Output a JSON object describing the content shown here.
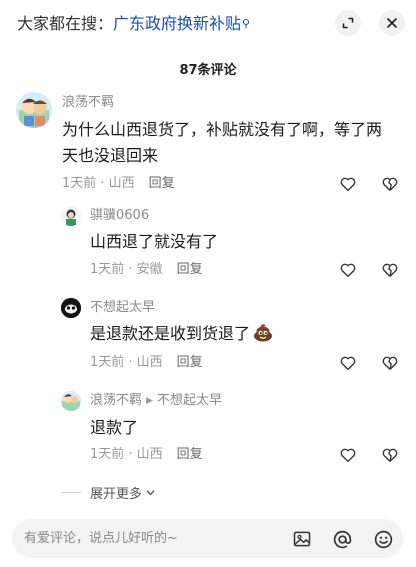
{
  "header": {
    "search_prefix": "大家都在搜：",
    "search_keyword": "广东政府换新补贴",
    "icons": {
      "expand": "expand-icon",
      "close": "close-icon"
    }
  },
  "comment_count": "87条评论",
  "comments": [
    {
      "username": "浪荡不羁",
      "text_line1": "为什么山西退货了，补贴就没有了啊，等了两",
      "text_line2": "天也没退回来",
      "time_location": "1天前 · 山西",
      "reply_label": "回复"
    },
    {
      "username": "骐骥0606",
      "text": "山西退了就没有了",
      "time_location": "1天前 · 安徽",
      "reply_label": "回复"
    },
    {
      "username": "不想起太早",
      "text": "是退款还是收到货退了",
      "time_location": "1天前 · 山西",
      "reply_label": "回复"
    },
    {
      "username": "浪荡不羁",
      "reply_to": "不想起太早",
      "text": "退款了",
      "time_location": "1天前 · 山西",
      "reply_label": "回复"
    }
  ],
  "more_replies_label": "展开更多",
  "input_bar": {
    "placeholder": "有爱评论，说点儿好听的~",
    "icons": [
      "image-icon",
      "at-icon",
      "emoji-icon"
    ]
  },
  "colors": {
    "keyword": "#1f4fa3",
    "muted": "#9a9a9a",
    "text": "#1a1a1a"
  }
}
